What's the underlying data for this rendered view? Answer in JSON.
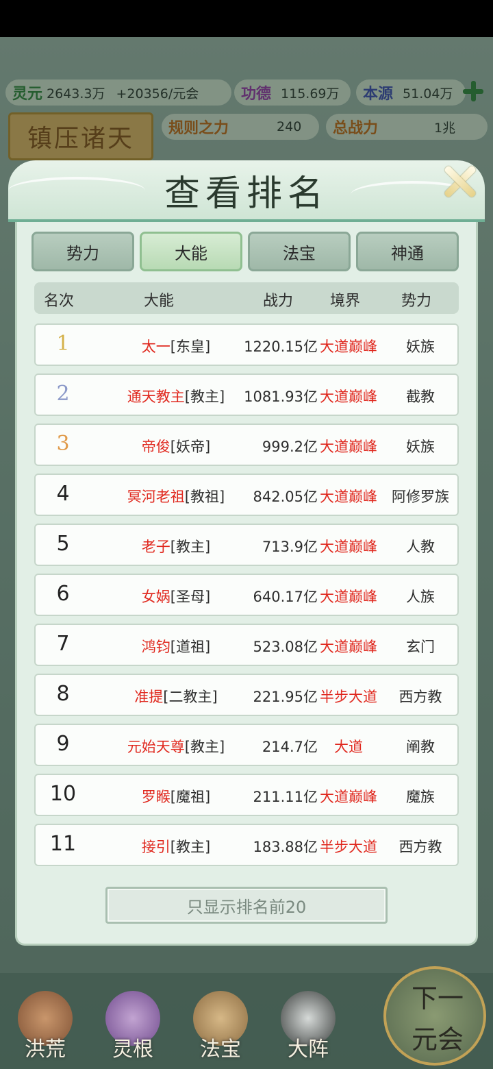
{
  "resources": {
    "lingyuan": {
      "name": "灵元",
      "value": "2643.3万",
      "rate": "+20356/元会"
    },
    "gongde": {
      "name": "功德",
      "value": "115.69万"
    },
    "benyuan": {
      "name": "本源",
      "value": "51.04万"
    },
    "guize": {
      "name": "规则之力",
      "value": "240"
    },
    "zongzhanli": {
      "name": "总战力",
      "value": "1兆"
    }
  },
  "plaque": "镇压诸天",
  "modal": {
    "title": "查看排名",
    "tabs": [
      "势力",
      "大能",
      "法宝",
      "神通"
    ],
    "active_tab": "大能",
    "columns": [
      "名次",
      "大能",
      "战力",
      "境界",
      "势力"
    ],
    "rows": [
      {
        "rank": "1",
        "name": "太一",
        "title": "[东皇]",
        "power": "1220.15亿",
        "realm": "大道巅峰",
        "faction": "妖族"
      },
      {
        "rank": "2",
        "name": "通天教主",
        "title": "[教主]",
        "power": "1081.93亿",
        "realm": "大道巅峰",
        "faction": "截教"
      },
      {
        "rank": "3",
        "name": "帝俊",
        "title": "[妖帝]",
        "power": "999.2亿",
        "realm": "大道巅峰",
        "faction": "妖族"
      },
      {
        "rank": "4",
        "name": "冥河老祖",
        "title": "[教祖]",
        "power": "842.05亿",
        "realm": "大道巅峰",
        "faction": "阿修罗族"
      },
      {
        "rank": "5",
        "name": "老子",
        "title": "[教主]",
        "power": "713.9亿",
        "realm": "大道巅峰",
        "faction": "人教"
      },
      {
        "rank": "6",
        "name": "女娲",
        "title": "[圣母]",
        "power": "640.17亿",
        "realm": "大道巅峰",
        "faction": "人族"
      },
      {
        "rank": "7",
        "name": "鸿钧",
        "title": "[道祖]",
        "power": "523.08亿",
        "realm": "大道巅峰",
        "faction": "玄门"
      },
      {
        "rank": "8",
        "name": "准提",
        "title": "[二教主]",
        "power": "221.95亿",
        "realm": "半步大道",
        "faction": "西方教"
      },
      {
        "rank": "9",
        "name": "元始天尊",
        "title": "[教主]",
        "power": "214.7亿",
        "realm": "大道",
        "faction": "阐教"
      },
      {
        "rank": "10",
        "name": "罗睺",
        "title": "[魔祖]",
        "power": "211.11亿",
        "realm": "大道巅峰",
        "faction": "魔族"
      },
      {
        "rank": "11",
        "name": "接引",
        "title": "[教主]",
        "power": "183.88亿",
        "realm": "半步大道",
        "faction": "西方教"
      }
    ],
    "bottom_button": "只显示排名前20"
  },
  "bottom_nav": {
    "items": [
      "洪荒",
      "灵根",
      "法宝",
      "大阵"
    ],
    "next": {
      "line1": "下一",
      "line2": "元会"
    }
  },
  "colors": {
    "highlight_red": "#e0281e",
    "rank1": "#d4b14a",
    "rank2": "#8a98c8",
    "rank3": "#e09a4a"
  }
}
